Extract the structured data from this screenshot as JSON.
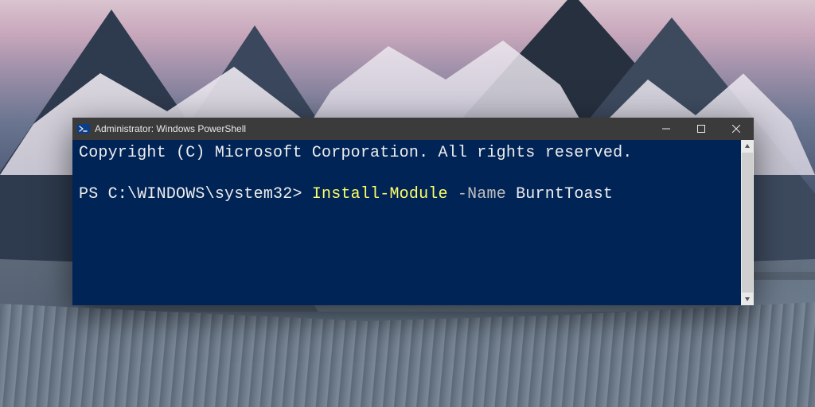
{
  "window": {
    "title": "Administrator: Windows PowerShell",
    "icon": "powershell-icon"
  },
  "titlebar_buttons": {
    "minimize": "Minimize",
    "maximize": "Maximize",
    "close": "Close"
  },
  "console": {
    "copyright_line": "Copyright (C) Microsoft Corporation. All rights reserved.",
    "prompt": "PS C:\\WINDOWS\\system32>",
    "command": "Install-Module",
    "param_flag": "-Name",
    "param_value": "BurntToast"
  },
  "colors": {
    "console_bg": "#012456",
    "console_fg": "#eeeeee",
    "cmd_highlight": "#ffff66",
    "param_gray": "#bfbfbf",
    "titlebar_bg": "#3b3b3b"
  }
}
